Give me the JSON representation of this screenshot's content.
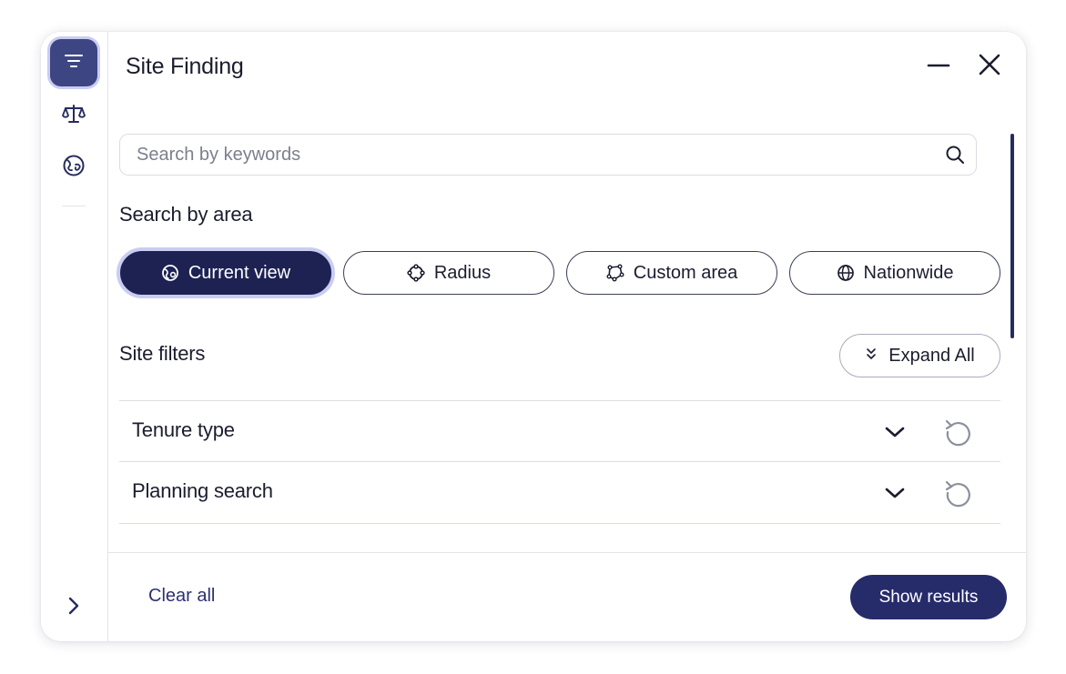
{
  "panel": {
    "title": "Site Finding"
  },
  "rail": {
    "items": [
      {
        "icon": "filter-icon",
        "active": true
      },
      {
        "icon": "scales-icon",
        "active": false
      },
      {
        "icon": "globe-icon",
        "active": false
      }
    ],
    "expand_icon": "chevron-right-icon"
  },
  "search": {
    "placeholder": "Search by keywords",
    "value": ""
  },
  "area": {
    "heading": "Search by area",
    "options": [
      {
        "label": "Current view",
        "icon": "map-view-icon",
        "selected": true
      },
      {
        "label": "Radius",
        "icon": "radius-icon",
        "selected": false
      },
      {
        "label": "Custom area",
        "icon": "polygon-icon",
        "selected": false
      },
      {
        "label": "Nationwide",
        "icon": "globe-icon",
        "selected": false
      }
    ]
  },
  "filters": {
    "heading": "Site filters",
    "expand_label": "Expand All",
    "rows": [
      {
        "label": "Tenure type"
      },
      {
        "label": "Planning search"
      }
    ]
  },
  "footer": {
    "clear_label": "Clear all",
    "show_label": "Show results"
  },
  "colors": {
    "accent": "#262b6a",
    "active_rail": "#3e4583",
    "active_pill": "#1d2253",
    "focus_ring": "#c9cdf2"
  }
}
